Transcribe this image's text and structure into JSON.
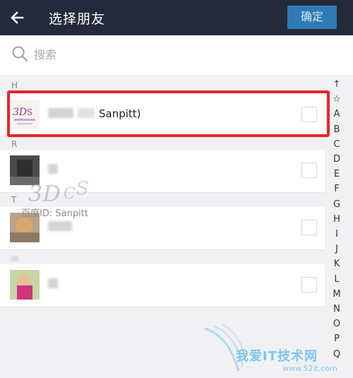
{
  "header": {
    "title": "选择朋友",
    "confirm_label": "确定"
  },
  "search": {
    "placeholder": "搜索"
  },
  "sections": [
    {
      "letter": "H"
    },
    {
      "letter": "R"
    },
    {
      "letter": "T"
    }
  ],
  "friends": [
    {
      "name": "Sanpitt)",
      "selected": false,
      "highlighted": true
    },
    {
      "name": "",
      "selected": false
    },
    {
      "name": "",
      "selected": false
    },
    {
      "name": "",
      "selected": false
    }
  ],
  "index_letters": [
    "↑",
    "☆",
    "A",
    "B",
    "C",
    "D",
    "E",
    "F",
    "G",
    "H",
    "I",
    "J",
    "K",
    "L",
    "M",
    "N",
    "O",
    "P",
    "Q"
  ],
  "watermark": {
    "text": "百度ID: Sanpitt"
  },
  "brand_watermark": {
    "text": "我爱IT技术网",
    "url": "www.52it.com"
  },
  "colors": {
    "titlebar": "#252a3a",
    "confirm_button": "#2f7bb6",
    "highlight_border": "#e8242b"
  }
}
